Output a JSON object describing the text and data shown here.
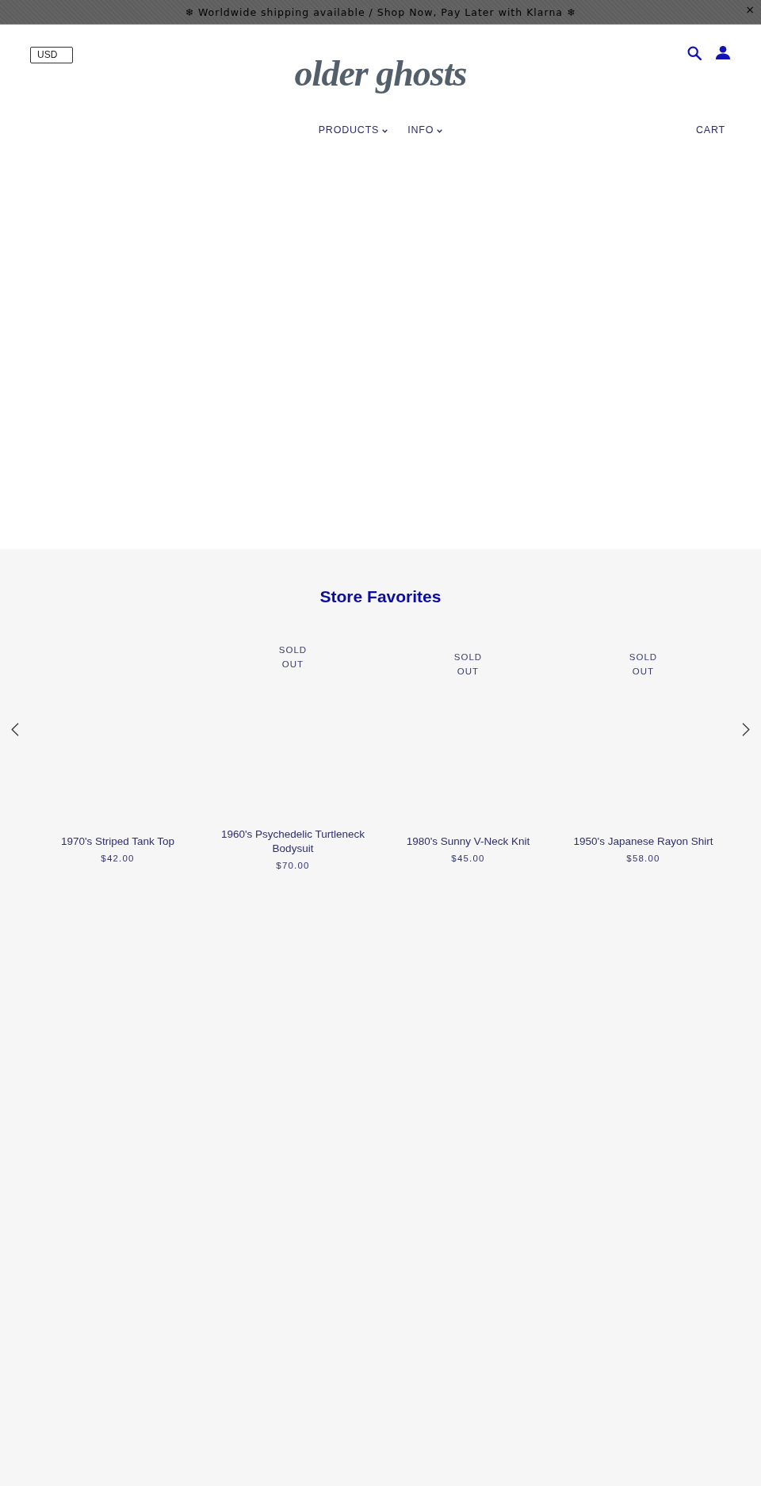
{
  "announcement_bar": {
    "text": "❄ Worldwide shipping available / Shop Now, Pay Later with Klarna ❄",
    "close": "×"
  },
  "header": {
    "currency": "USD",
    "logo": "older ghosts",
    "nav": [
      {
        "label": "PRODUCTS",
        "dropdown": true
      },
      {
        "label": "INFO",
        "dropdown": true
      }
    ],
    "cart": "CART"
  },
  "store_favorites": {
    "title": "Store Favorites",
    "products": [
      {
        "title": "1970's Striped Tank Top",
        "price": "$42.00"
      },
      {
        "title": "1960's Psychedelic Turtleneck Bodysuit",
        "price": "$70.00",
        "badge": "SOLD OUT"
      },
      {
        "title": "1980's Sunny V-Neck Knit",
        "price": "$45.00",
        "badge": "SOLD OUT"
      },
      {
        "title": "1950's Japanese Rayon Shirt",
        "price": "$58.00",
        "badge": "SOLD OUT"
      }
    ]
  }
}
